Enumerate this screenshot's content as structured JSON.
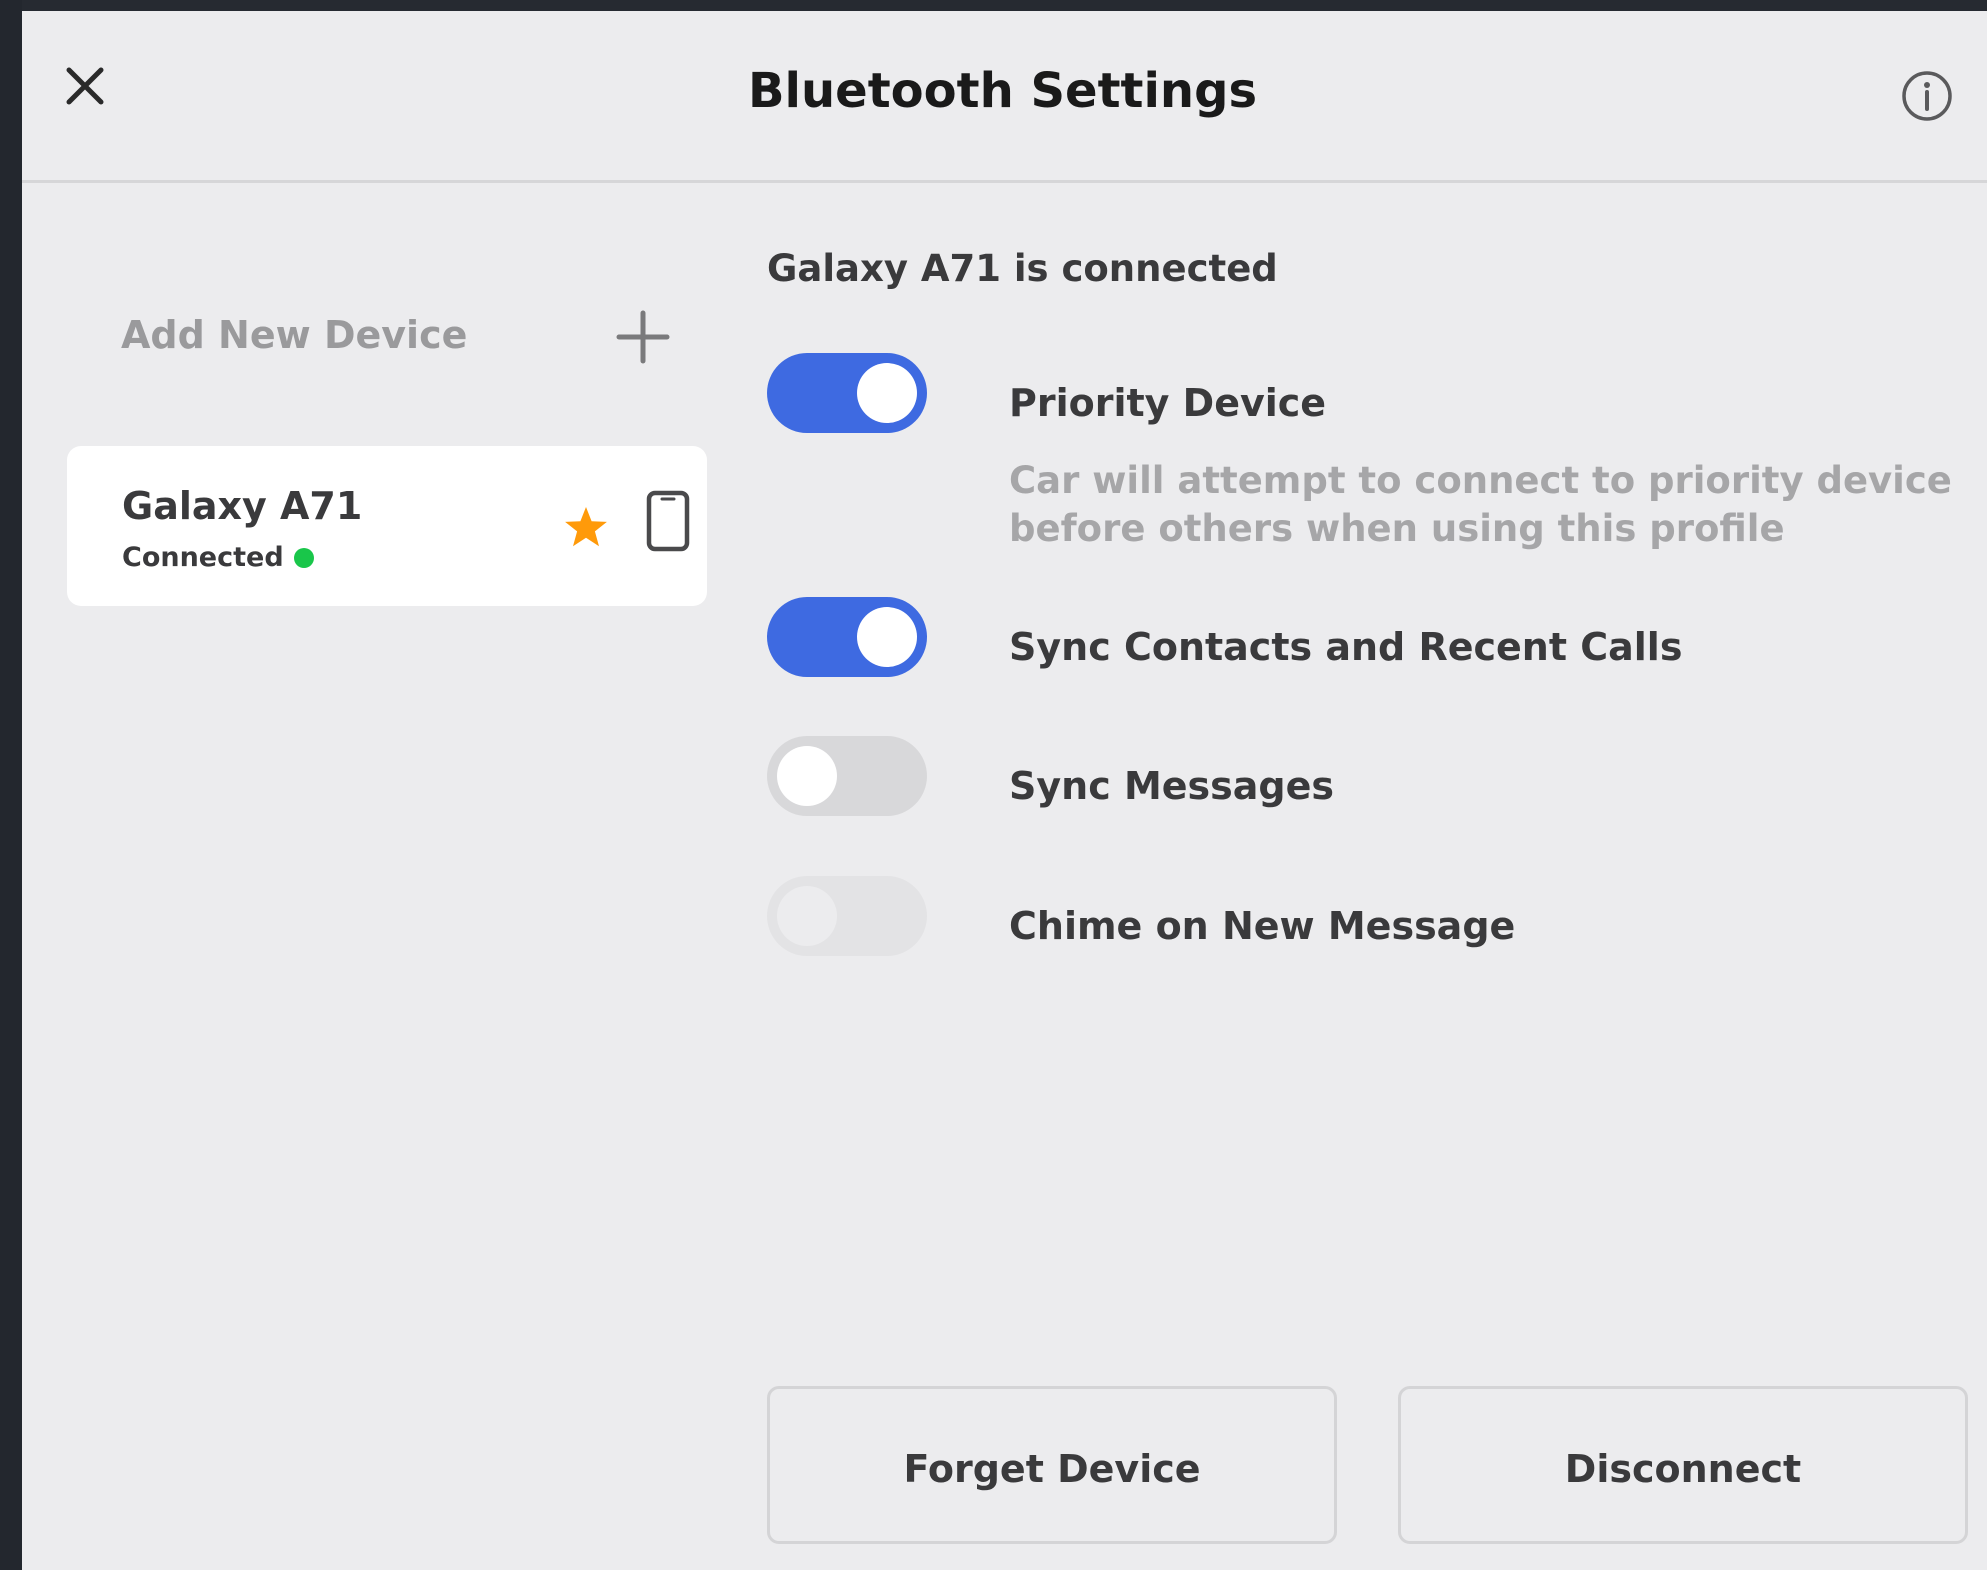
{
  "header": {
    "title": "Bluetooth Settings",
    "close_icon": "close-icon",
    "info_icon": "info-icon"
  },
  "sidebar": {
    "add_device_label": "Add New Device",
    "add_icon": "plus-icon",
    "devices": [
      {
        "name": "Galaxy A71",
        "status": "Connected",
        "status_color": "#19c64a",
        "priority_icon": "star-icon",
        "priority_color": "#ff9a0a",
        "device_icon": "phone-icon"
      }
    ]
  },
  "detail": {
    "heading": "Galaxy A71 is connected",
    "options": [
      {
        "label": "Priority Device",
        "enabled": true,
        "description": "Car will attempt to connect to priority device before others when using this profile"
      },
      {
        "label": "Sync Contacts and Recent Calls",
        "enabled": true
      },
      {
        "label": "Sync Messages",
        "enabled": false
      },
      {
        "label": "Chime on New Message",
        "enabled": false,
        "disabled": true
      }
    ],
    "buttons": {
      "forget": "Forget Device",
      "disconnect": "Disconnect"
    }
  },
  "colors": {
    "accent": "#3e6ae1",
    "background": "#ececee",
    "card": "#ffffff"
  }
}
